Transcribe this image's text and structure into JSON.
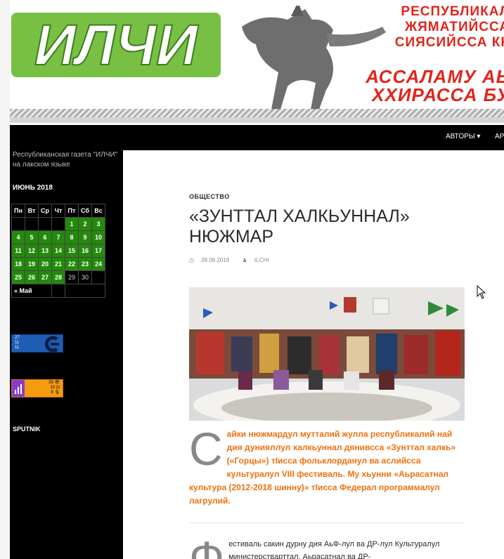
{
  "header": {
    "logo_text": "ИЛЧИ",
    "slogan_line1": "РЕСПУБЛИКАЛ",
    "slogan_line2": "ЖЯМАТИЙССА",
    "slogan_line3": "СИЯСИЙССА КК",
    "slogan_line4": "АССАЛАМУ АЬ",
    "slogan_line5": "ХХИРАССА БУ"
  },
  "nav": {
    "authors": "АВТОРЫ ▾",
    "more": "АР"
  },
  "sidebar": {
    "description": "Республиканская газета \"ИЛЧИ\" на лакском языке",
    "calendar": {
      "title": "ИЮНЬ 2018",
      "weekdays": [
        "Пн",
        "Вт",
        "Ср",
        "Чт",
        "Пт",
        "Сб",
        "Вс"
      ],
      "prev_link": "« Май"
    },
    "widget1_lines": [
      "27",
      "11",
      "11"
    ],
    "widget2_lines": [
      "26 👁",
      "10 ⊡",
      "9 🎙"
    ],
    "sputnik": "SPUTNIK"
  },
  "post": {
    "category": "ОБЩЕСТВО",
    "title": "«ЗУНТТАЛ ХАЛКЬУННАЛ» НЮЖМАР",
    "date": "28.06.2018",
    "author": "ILCHI",
    "lead_drop": "С",
    "lead_text": "айки нюжмардул мутталий жулла республикалий най дия дунияллул халкьуннал дянивсса «Зунттал халкь» («Горцы») тIисса фольклорданул ва аслийсса культуралул VIII фестиваль. Му хьунни «Аьрасатнал культура (2012-2018 шинну)» тIисса Федерал программалул лагрулий.",
    "body_drop": "Ф",
    "body_text": "естиваль сакин дурну дия АьФ-лул ва ДР-лул Культуралул министерстварттал. Аьрасатнал ва ДР-"
  },
  "colors": {
    "calendar_green": "#24890d",
    "lead_orange": "#f0700f",
    "banner_red": "#e0261c",
    "logo_green": "#77c043"
  }
}
